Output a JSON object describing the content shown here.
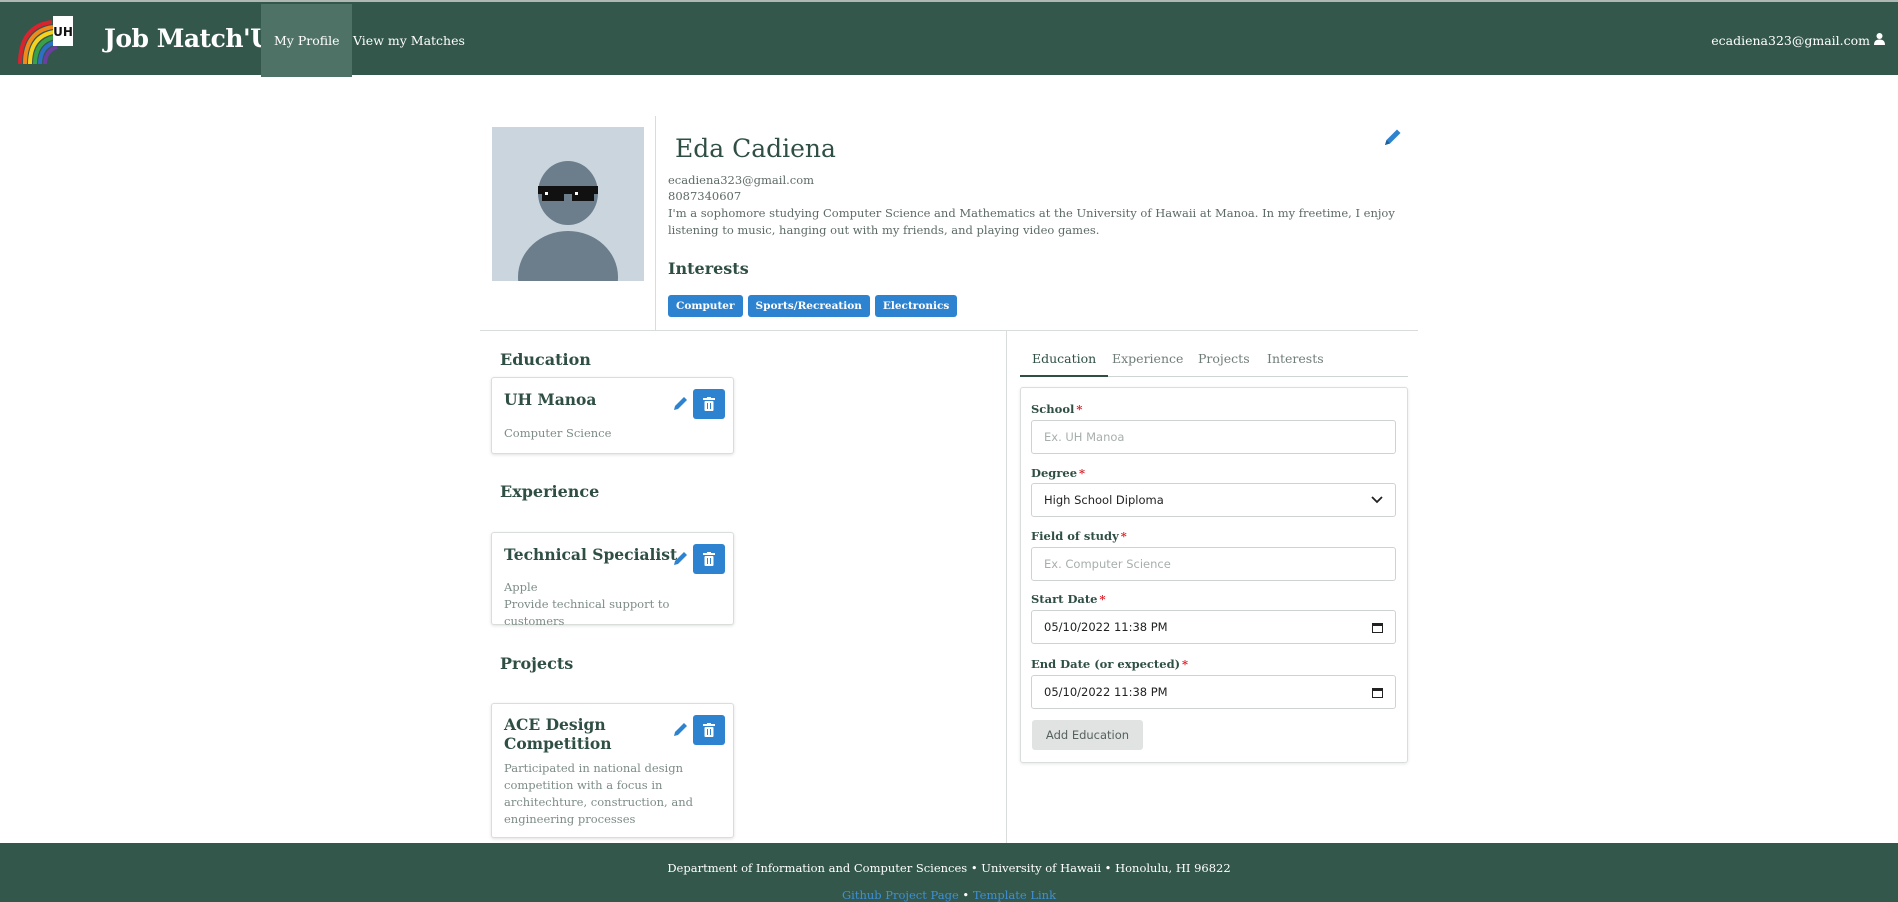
{
  "colors": {
    "navbar": "#33574b",
    "navbar_active": "#4f7267",
    "accent_blue": "#2d83cf",
    "text_dark_green": "#2f4f44",
    "required_red": "#d9232e"
  },
  "navbar": {
    "brand": "Job Match'UH",
    "logo_text": "UH",
    "items": [
      {
        "label": "My Profile",
        "active": true
      },
      {
        "label": "View my Matches",
        "active": false
      }
    ],
    "user": "ecadiena323@gmail.com",
    "user_icon": "user-icon"
  },
  "profile": {
    "name": "Eda Cadiena",
    "email": "ecadiena323@gmail.com",
    "phone": "8087340607",
    "bio": "I'm a sophomore studying Computer Science and Mathematics at the University of Hawaii at Manoa. In my freetime, I enjoy listening to music, hanging out with my friends, and playing video games.",
    "interests_heading": "Interests",
    "interests": [
      "Computer",
      "Sports/Recreation",
      "Electronics"
    ],
    "edit_icon": "pencil-icon"
  },
  "sections": {
    "education": {
      "heading": "Education",
      "items": [
        {
          "title": "UH Manoa",
          "lines": [
            "Computer Science"
          ]
        }
      ]
    },
    "experience": {
      "heading": "Experience",
      "items": [
        {
          "title": "Technical Specialist",
          "lines": [
            "Apple",
            "Provide technical support to customers"
          ]
        }
      ]
    },
    "projects": {
      "heading": "Projects",
      "items": [
        {
          "title": "ACE Design Competition",
          "lines": [
            "Participated in national design competition with a focus in architechture, construction, and engineering processes"
          ]
        }
      ]
    }
  },
  "form": {
    "tabs": [
      {
        "label": "Education",
        "active": true
      },
      {
        "label": "Experience",
        "active": false
      },
      {
        "label": "Projects",
        "active": false
      },
      {
        "label": "Interests",
        "active": false
      }
    ],
    "required_mark": "*",
    "school": {
      "label": "School",
      "placeholder": "Ex. UH Manoa"
    },
    "degree": {
      "label": "Degree",
      "value": "High School Diploma"
    },
    "field_of_study": {
      "label": "Field of study",
      "placeholder": "Ex. Computer Science"
    },
    "start_date": {
      "label": "Start Date",
      "value": "05/10/2022 11:38 PM"
    },
    "end_date": {
      "label": "End Date (or expected)",
      "value": "05/10/2022 11:38 PM"
    },
    "submit_label": "Add Education"
  },
  "footer": {
    "line1": "Department of Information and Computer Sciences • University of Hawaii • Honolulu, HI 96822",
    "link1": "Github Project Page",
    "separator": " • ",
    "link2": "Template Link"
  }
}
